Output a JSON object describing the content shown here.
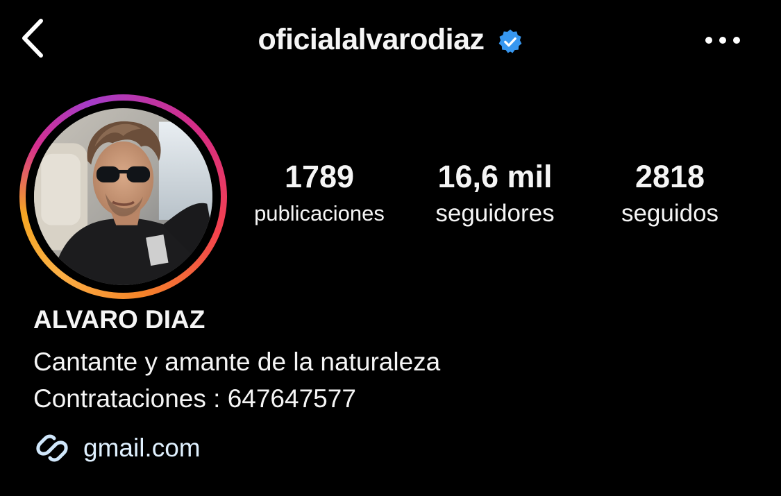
{
  "header": {
    "username": "oficialalvarodiaz",
    "back_icon": "chevron-left-icon",
    "verified_icon": "verified-badge-icon",
    "more_icon": "more-horizontal-icon"
  },
  "profile": {
    "avatar": "profile-photo",
    "story_ring_colors": [
      "#a43cc9",
      "#d62f8f",
      "#f4424e",
      "#f58529",
      "#fcb045"
    ],
    "stats": [
      {
        "value": "1789",
        "label": "publicaciones"
      },
      {
        "value": "16,6 mil",
        "label": "seguidores"
      },
      {
        "value": "2818",
        "label": "seguidos"
      }
    ],
    "full_name": "ALVARO DIAZ",
    "bio": [
      "Cantante y amante de la naturaleza",
      "Contrataciones : 647647577"
    ],
    "link": {
      "icon": "link-icon",
      "text": "gmail.com"
    }
  },
  "colors": {
    "background": "#000000",
    "text": "#f5f5f5",
    "verified_blue": "#3797f0",
    "link_text": "#e0f1ff"
  }
}
